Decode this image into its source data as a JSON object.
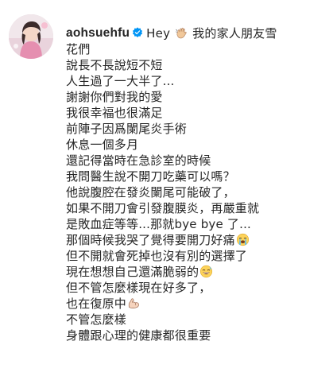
{
  "post": {
    "username": "aohsuehfu",
    "first_line_text": "Hey",
    "first_line_after_emoji": "我的家人朋友雪",
    "lines": [
      "花們",
      "說長不長說短不短",
      "人生過了一大半了...",
      "謝謝你們對我的愛",
      "我很幸福也很滿足",
      "前陣子因爲闌尾炎手術",
      "休息一個多月",
      "還記得當時在急診室的時候",
      "我問醫生說不開刀吃藥可以嗎？",
      "他說腹腔在發炎闌尾可能破了，",
      "如果不開刀會引發腹膜炎，再嚴重就",
      "是敗血症等等...那就bye bye 了...",
      "那個時候我哭了覺得要開刀好痛",
      "但不開就會死掉也沒有別的選擇了",
      "現在想想自己還滿脆弱的",
      "但不管怎麼樣現在好多了，",
      "也在復原中",
      "不管怎麼樣",
      "身體跟心理的健康都很重要"
    ],
    "emojis": {
      "wave": "waving-hand-emoji",
      "cry": "loudly-crying-face-emoji",
      "laugh": "grinning-sweat-emoji",
      "muscle": "flexed-biceps-emoji"
    },
    "colors": {
      "text": "#262626",
      "verified": "#0095f6"
    }
  }
}
